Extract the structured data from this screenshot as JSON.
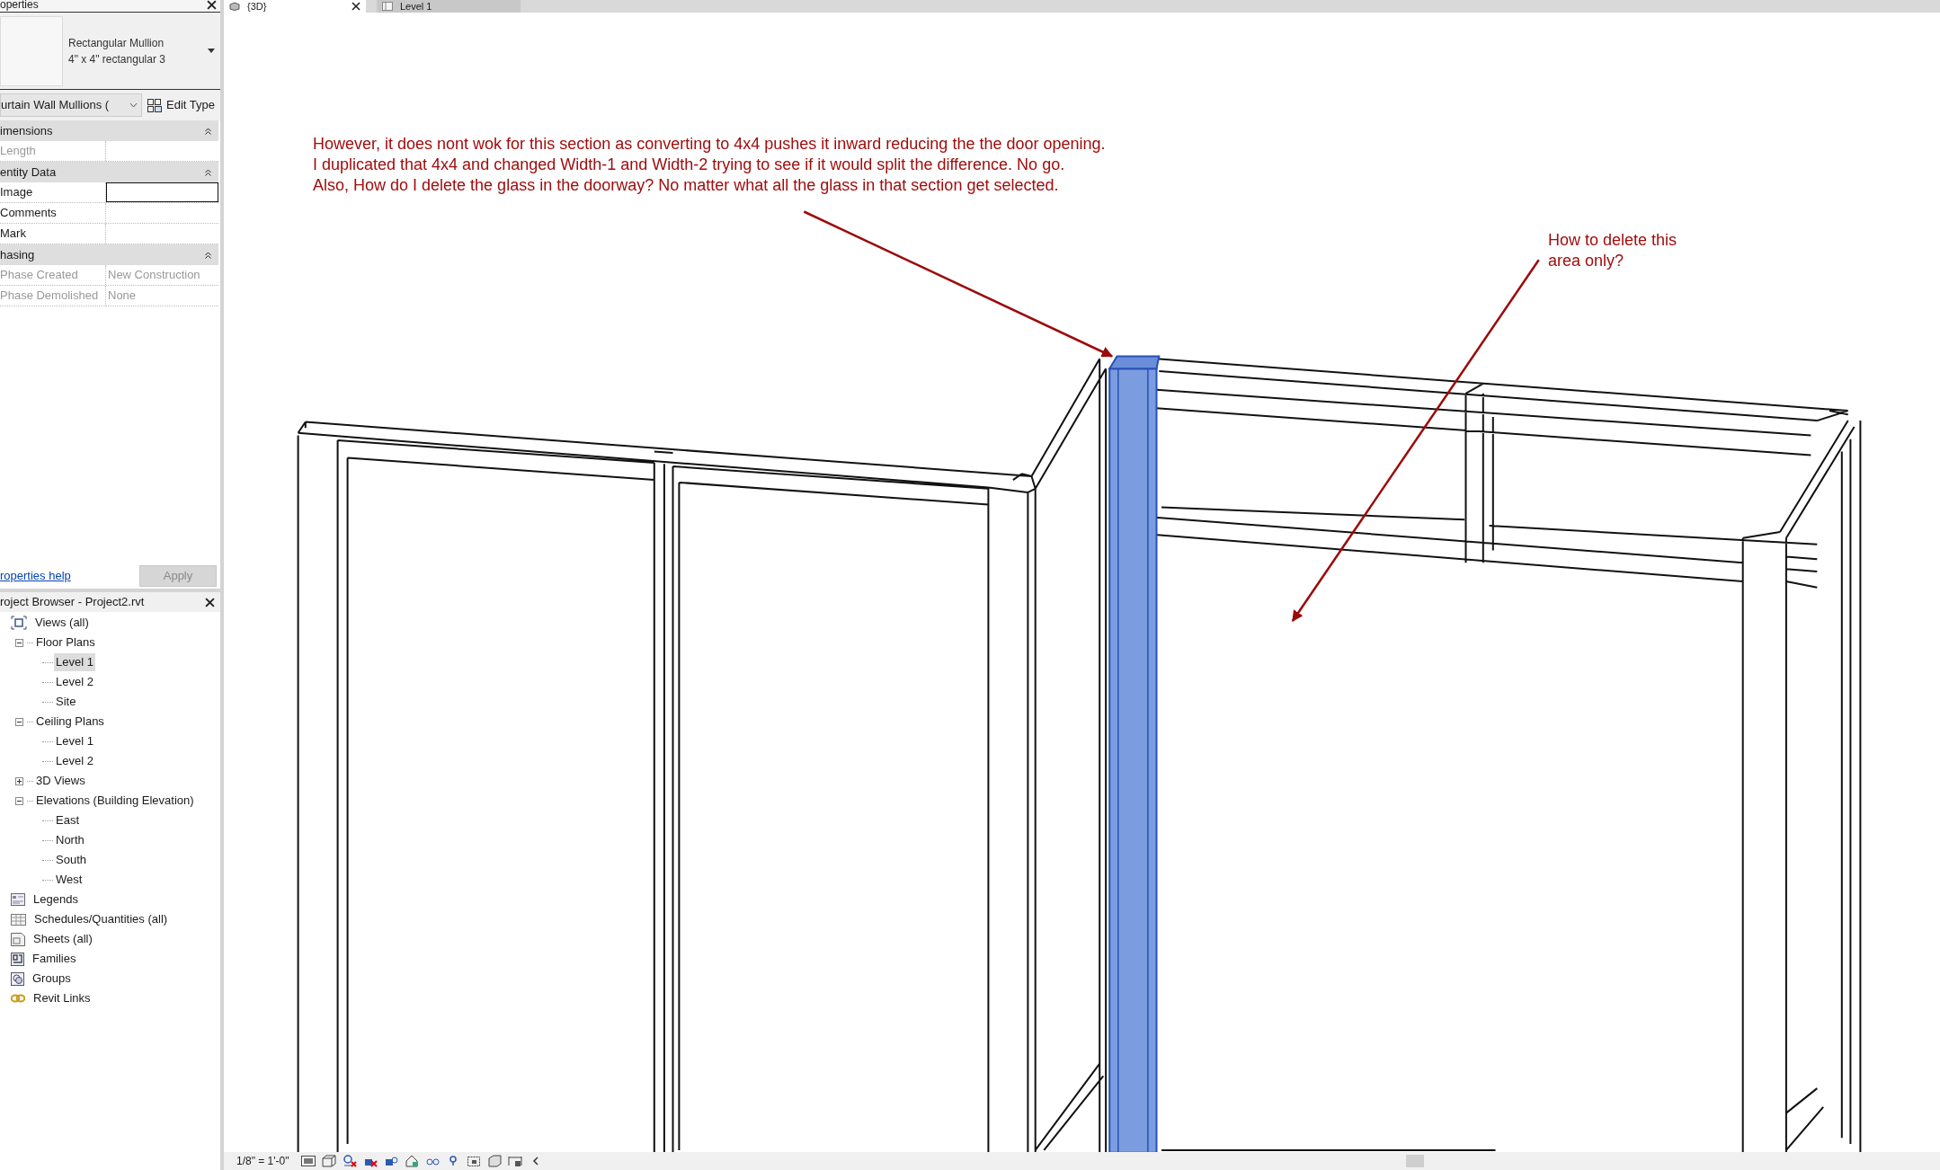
{
  "properties": {
    "title": "operties",
    "type_selector": {
      "family": "Rectangular Mullion",
      "type": "4\" x 4\" rectangular 3"
    },
    "instance_filter": "urtain Wall Mullions (",
    "edit_type": "Edit Type",
    "groups": [
      {
        "name": "imensions",
        "rows": [
          {
            "label": "Length",
            "value": "",
            "disabled": true,
            "focused": false
          }
        ]
      },
      {
        "name": "entity Data",
        "rows": [
          {
            "label": "Image",
            "value": "",
            "disabled": false,
            "focused": true
          },
          {
            "label": "Comments",
            "value": "",
            "disabled": false,
            "focused": false
          },
          {
            "label": "Mark",
            "value": "",
            "disabled": false,
            "focused": false
          }
        ]
      },
      {
        "name": "hasing",
        "rows": [
          {
            "label": "Phase Created",
            "value": "New Construction",
            "disabled": true,
            "focused": false
          },
          {
            "label": "Phase Demolished",
            "value": "None",
            "disabled": true,
            "focused": false
          }
        ]
      }
    ],
    "help_link": "roperties help",
    "apply": {
      "label": "Apply",
      "disabled": true
    }
  },
  "project_browser": {
    "title": "roject Browser - Project2.rvt",
    "tree": [
      {
        "label": "Views (all)",
        "kind": "views",
        "selected": false,
        "children": [
          {
            "label": "Floor Plans",
            "expanded": true,
            "selected": false,
            "children": [
              {
                "label": "Level 1",
                "selected": true
              },
              {
                "label": "Level 2",
                "selected": false
              },
              {
                "label": "Site",
                "selected": false
              }
            ]
          },
          {
            "label": "Ceiling Plans",
            "expanded": true,
            "selected": false,
            "children": [
              {
                "label": "Level 1",
                "selected": false
              },
              {
                "label": "Level 2",
                "selected": false
              }
            ]
          },
          {
            "label": "3D Views",
            "expanded": false,
            "selected": false
          },
          {
            "label": "Elevations (Building Elevation)",
            "expanded": true,
            "selected": false,
            "children": [
              {
                "label": "East",
                "selected": false
              },
              {
                "label": "North",
                "selected": false
              },
              {
                "label": "South",
                "selected": false
              },
              {
                "label": "West",
                "selected": false
              }
            ]
          }
        ]
      },
      {
        "label": "Legends",
        "kind": "legends",
        "selected": false
      },
      {
        "label": "Schedules/Quantities (all)",
        "kind": "schedules",
        "selected": false
      },
      {
        "label": "Sheets (all)",
        "kind": "sheets",
        "selected": false
      },
      {
        "label": "Families",
        "kind": "families",
        "selected": false
      },
      {
        "label": "Groups",
        "kind": "groups",
        "selected": false
      },
      {
        "label": "Revit Links",
        "kind": "links",
        "selected": false
      }
    ]
  },
  "view_tabs": [
    {
      "label": "{3D}",
      "selected": true
    },
    {
      "label": "Level 1",
      "selected": false
    }
  ],
  "annotations": [
    {
      "kind": "note",
      "lines": [
        "However, it does nont wok for this section as converting to 4x4 pushes it inward reducing the the door opening.",
        "I duplicated that 4x4 and changed Width-1 and Width-2 trying to see if it would split the difference. No go.",
        "Also, How do I delete the glass in the doorway? No matter what all the glass in that section get selected."
      ]
    },
    {
      "kind": "question",
      "lines": [
        "How to delete this",
        "area only?"
      ]
    }
  ],
  "status_bar": {
    "scale": "1/8\" = 1'-0\""
  }
}
